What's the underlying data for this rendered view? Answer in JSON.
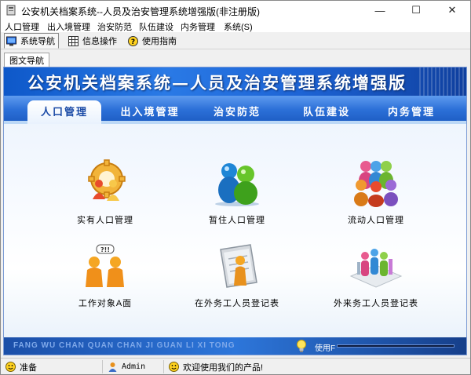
{
  "window": {
    "title": "公安机关档案系统--人员及治安管理系统增强版(非注册版)",
    "minimize_glyph": "—",
    "maximize_glyph": "☐",
    "close_glyph": "✕"
  },
  "menubar": {
    "items": [
      "人口管理",
      "出入境管理",
      "治安防范",
      "队伍建设",
      "内务管理",
      "系统(S)"
    ]
  },
  "toolbar": {
    "items": [
      {
        "label": "系统导航",
        "icon": "monitor-icon",
        "active": true
      },
      {
        "label": "信息操作",
        "icon": "grid-icon",
        "active": false
      },
      {
        "label": "使用指南",
        "icon": "help-icon",
        "active": false
      }
    ]
  },
  "subtab": {
    "label": "图文导航"
  },
  "banner": {
    "title": "公安机关档案系统—人员及治安管理系统增强版"
  },
  "main_tabs": [
    {
      "label": "人口管理",
      "active": true
    },
    {
      "label": "出入境管理",
      "active": false
    },
    {
      "label": "治安防范",
      "active": false
    },
    {
      "label": "队伍建设",
      "active": false
    },
    {
      "label": "内务管理",
      "active": false
    }
  ],
  "modules": [
    {
      "label": "实有人口管理",
      "icon": "gear-people-icon"
    },
    {
      "label": "暂住人口管理",
      "icon": "two-people-icon"
    },
    {
      "label": "流动人口管理",
      "icon": "crowd-icon"
    },
    {
      "label": "工作对象A面",
      "icon": "question-people-icon"
    },
    {
      "label": "在外务工人员登记表",
      "icon": "clipboard-person-icon"
    },
    {
      "label": "外来务工人员登记表",
      "icon": "group-board-icon"
    }
  ],
  "footer": {
    "pinyin": "FANG WU CHAN QUAN CHAN JI GUAN LI XI TONG",
    "usage_label": "使用F"
  },
  "statusbar": {
    "ready": "准备",
    "user": "Admin",
    "welcome": "欢迎使用我们的产品!"
  },
  "colors": {
    "banner_blue": "#1d63d4",
    "active_tab_text": "#1a4aa6",
    "footer_text": "#7fa9ea"
  }
}
